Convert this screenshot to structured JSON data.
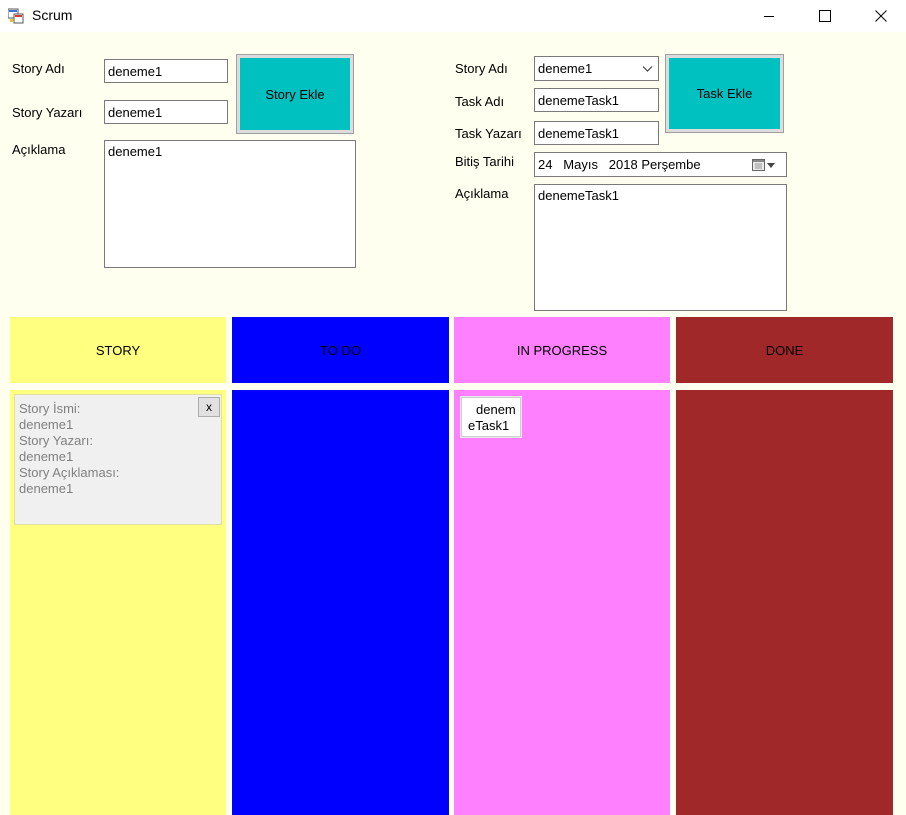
{
  "window": {
    "title": "Scrum",
    "buttons": {
      "minimize": "minimize",
      "maximize": "maximize",
      "close": "close"
    }
  },
  "story_form": {
    "story_name_label": "Story Adı",
    "story_name_value": "deneme1",
    "story_author_label": "Story Yazarı",
    "story_author_value": "deneme1",
    "description_label": "Açıklama",
    "description_value": "deneme1",
    "add_button": "Story Ekle"
  },
  "task_form": {
    "story_name_label": "Story Adı",
    "story_name_selected": "deneme1",
    "task_name_label": "Task Adı",
    "task_name_value": "denemeTask1",
    "task_author_label": "Task Yazarı",
    "task_author_value": "denemeTask1",
    "due_date_label": "Bitiş Tarihi",
    "due_date_value": "24   Mayıs   2018 Perşembe",
    "description_label": "Açıklama",
    "description_value": "denemeTask1",
    "add_button": "Task Ekle"
  },
  "board": {
    "columns": [
      {
        "title": "STORY",
        "color": "#ffff80"
      },
      {
        "title": "TO DO",
        "color": "#0000ff"
      },
      {
        "title": "IN PROGRESS",
        "color": "#ff80ff"
      },
      {
        "title": "DONE",
        "color": "#a02828"
      }
    ],
    "story_card": {
      "close_label": "x",
      "lines": [
        "Story İsmi:",
        "deneme1",
        "Story Yazarı:",
        "deneme1",
        "Story Açıklaması:",
        "deneme1"
      ]
    },
    "task_card": {
      "lines": [
        "denem",
        "eTask1"
      ]
    }
  }
}
